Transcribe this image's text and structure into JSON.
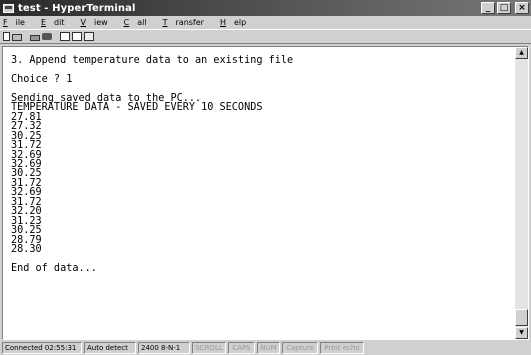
{
  "window": {
    "title": "test - HyperTerminal",
    "buttons": {
      "minimize": "_",
      "maximize": "□",
      "close": "×"
    }
  },
  "menu": {
    "items": [
      {
        "accel": "F",
        "rest": "ile"
      },
      {
        "accel": "E",
        "rest": "dit"
      },
      {
        "accel": "V",
        "rest": "iew"
      },
      {
        "accel": "C",
        "rest": "all"
      },
      {
        "accel": "T",
        "rest": "ransfer"
      },
      {
        "accel": "H",
        "rest": "elp"
      }
    ]
  },
  "toolbar": {
    "icons": [
      "new-icon",
      "open-icon",
      "disconnect-icon",
      "call-icon",
      "send-icon",
      "receive-icon",
      "properties-icon"
    ]
  },
  "terminal": {
    "lines": [
      "3. Append temperature data to an existing file",
      "",
      "Choice ? 1",
      "",
      "Sending saved data to the PC...",
      "TEMPERATURE DATA - SAVED EVERY 10 SECONDS",
      "27.81",
      "27.32",
      "30.25",
      "31.72",
      "32.69",
      "32.69",
      "30.25",
      "31.72",
      "32.69",
      "31.72",
      "32.20",
      "31.23",
      "30.25",
      "28.79",
      "28.30",
      "",
      "End of data..."
    ]
  },
  "statusbar": {
    "connected": "Connected 02:55:31",
    "detect": "Auto detect",
    "settings": "2400 8-N-1",
    "scroll": "SCROLL",
    "caps": "CAPS",
    "num": "NUM",
    "capture": "Capture",
    "print_echo": "Print echo"
  }
}
